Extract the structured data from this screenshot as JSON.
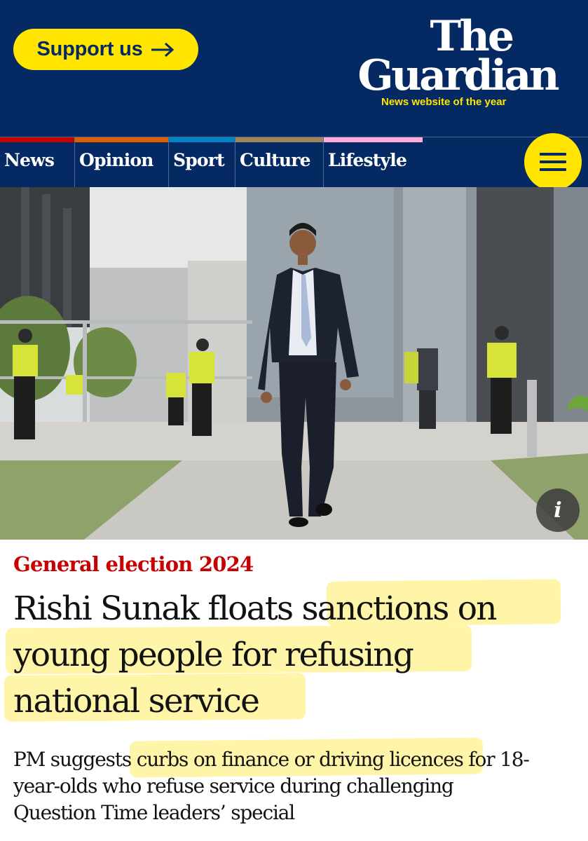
{
  "header": {
    "support_label": "Support us",
    "logo_line1": "The",
    "logo_line2": "Guardian",
    "tagline": "News website of the year"
  },
  "nav": {
    "items": [
      {
        "label": "News",
        "color": "#c70000"
      },
      {
        "label": "Opinion",
        "color": "#e05e00"
      },
      {
        "label": "Sport",
        "color": "#0084c6"
      },
      {
        "label": "Culture",
        "color": "#a1845c"
      },
      {
        "label": "Lifestyle",
        "color": "#ffabdb"
      }
    ],
    "menu_icon": "hamburger-menu-icon"
  },
  "image": {
    "info_label": "i"
  },
  "article": {
    "kicker": "General election 2024",
    "headline_lines": [
      "Rishi Sunak floats sanctions on",
      "young people for refusing",
      "national service"
    ],
    "standfirst_lines": [
      "PM suggests curbs on finance or driving licences for 18-",
      "year-olds who refuse service during challenging",
      "Question Time leaders’ special"
    ]
  },
  "colors": {
    "brand_blue": "#052962",
    "brand_yellow": "#ffe500",
    "kicker_red": "#c70000",
    "highlight": "#fff5a8"
  }
}
